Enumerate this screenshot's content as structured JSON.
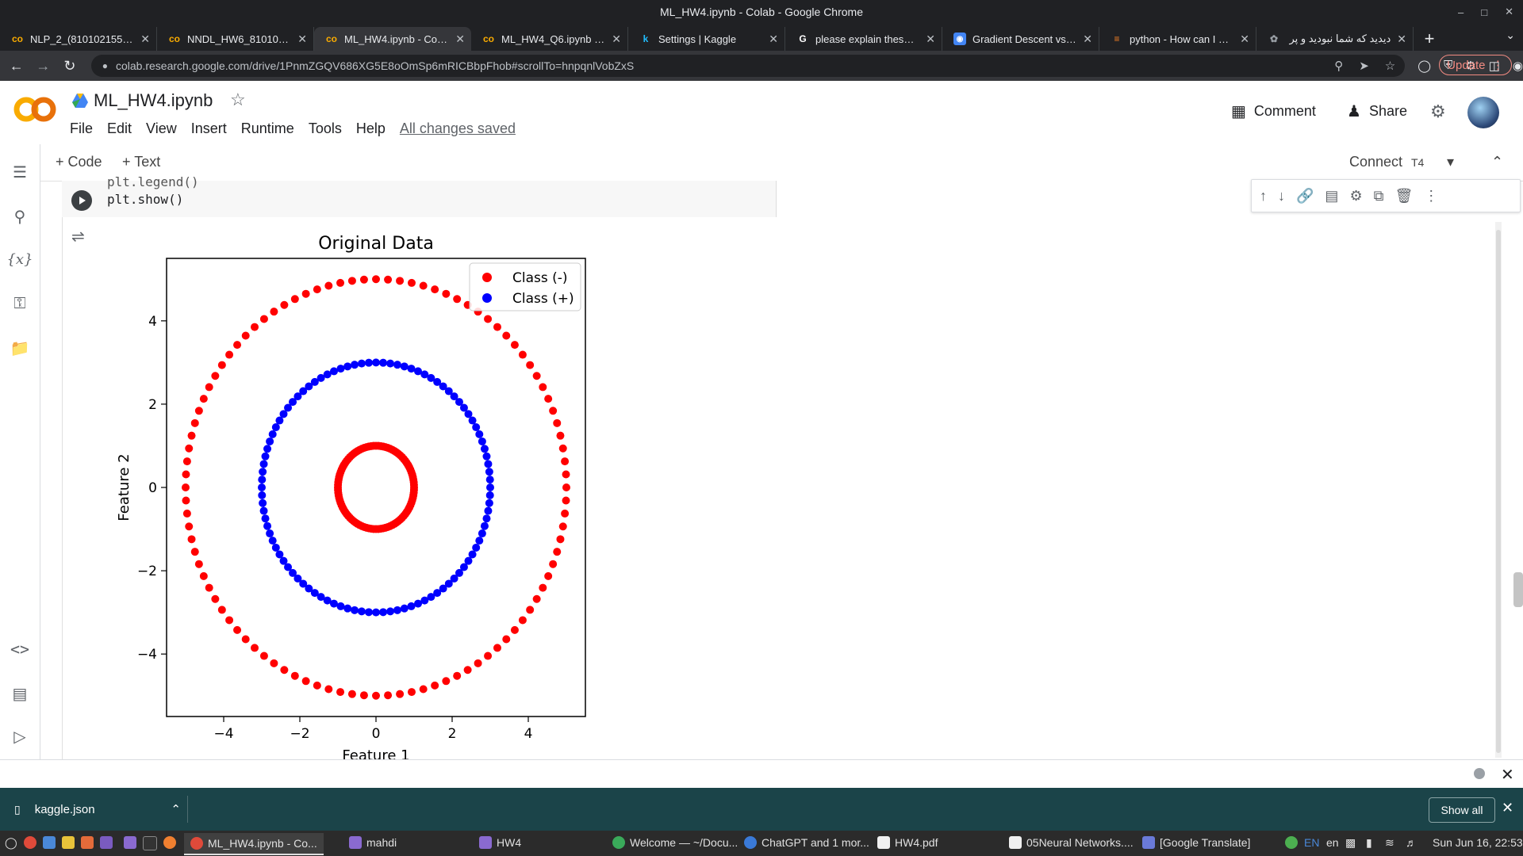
{
  "window": {
    "title": "ML_HW4.ipynb - Colab - Google Chrome"
  },
  "tabs": [
    {
      "label": "NLP_2_(810102155).ipy",
      "icon": "colab-icon"
    },
    {
      "label": "NNDL_HW6_81010215",
      "icon": "colab-icon"
    },
    {
      "label": "ML_HW4.ipynb - Colab",
      "icon": "colab-icon",
      "active": true
    },
    {
      "label": "ML_HW4_Q6.ipynb - Co",
      "icon": "colab-icon"
    },
    {
      "label": "Settings | Kaggle",
      "icon": "kaggle-icon"
    },
    {
      "label": "please explain these tw",
      "icon": "google-icon"
    },
    {
      "label": "Gradient Descent vs. N",
      "icon": "openai-icon"
    },
    {
      "label": "python - How can I prev",
      "icon": "stackoverflow-icon"
    },
    {
      "label": "دیدید که شما نبودید و پر",
      "icon": "web-icon"
    }
  ],
  "address": {
    "url": "colab.research.google.com/drive/1PnmZGQV686XG5E8oOmSp6mRICBbpFhob#scrollTo=hnpqnlVobZxS"
  },
  "browser": {
    "update_label": "Update"
  },
  "colab": {
    "notebook_title": "ML_HW4.ipynb",
    "menu": [
      "File",
      "Edit",
      "View",
      "Insert",
      "Runtime",
      "Tools",
      "Help"
    ],
    "saved_status": "All changes saved",
    "comment_label": "Comment",
    "share_label": "Share",
    "toolbar": {
      "code_label": "+ Code",
      "text_label": "+ Text",
      "connect_label": "Connect",
      "gpu_label": "T4"
    }
  },
  "cell": {
    "code_line_1": "plt.legend()",
    "code_line_2": "plt.show()"
  },
  "chart_data": {
    "type": "scatter",
    "title": "Original Data",
    "xlabel": "Feature 1",
    "ylabel": "Feature 2",
    "xlim": [
      -5.5,
      5.5
    ],
    "ylim": [
      -5.5,
      5.5
    ],
    "xticks": [
      -4,
      -2,
      0,
      2,
      4
    ],
    "yticks": [
      -4,
      -2,
      0,
      2,
      4
    ],
    "grid": false,
    "legend_position": "top-right",
    "series": [
      {
        "name": "Class (-)",
        "color": "#ff0000",
        "circles": [
          {
            "radius": 1,
            "points": 100
          },
          {
            "radius": 5,
            "points": 100
          }
        ]
      },
      {
        "name": "Class (+)",
        "color": "#0000ff",
        "circles": [
          {
            "radius": 3,
            "points": 100
          }
        ]
      }
    ]
  },
  "downloads": {
    "filename": "kaggle.json",
    "show_all_label": "Show all"
  },
  "taskbar": {
    "items": [
      "ML_HW4.ipynb - Co...",
      "mahdi",
      "HW4",
      "Welcome — ~/Docu...",
      "ChatGPT and 1 mor...",
      "HW4.pdf",
      "05Neural Networks....",
      "[Google Translate]"
    ],
    "lang": "EN",
    "lang2": "en",
    "clock": "Sun Jun 16, 22:53"
  }
}
